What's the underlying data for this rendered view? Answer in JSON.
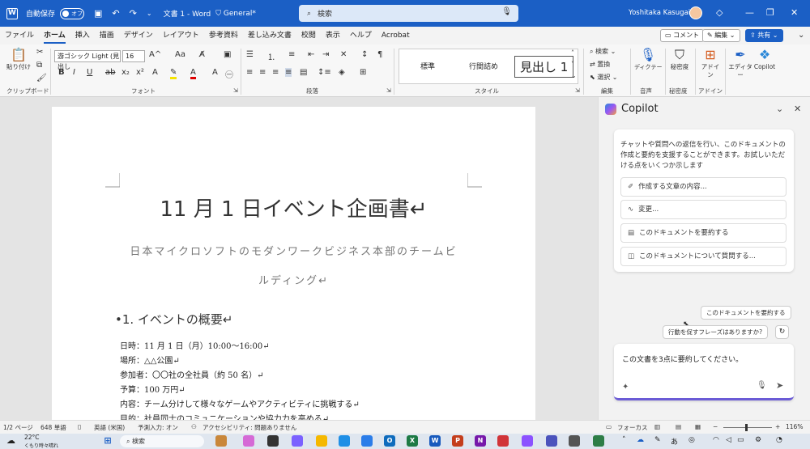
{
  "titlebar": {
    "autosave_label": "自動保存",
    "autosave_state": "オフ",
    "doc_title": "文書 1 - Word",
    "sensitivity": "General*",
    "search_placeholder": "検索",
    "user_name": "Yoshitaka Kasugai"
  },
  "tabs": [
    "ファイル",
    "ホーム",
    "挿入",
    "描画",
    "デザイン",
    "レイアウト",
    "参考資料",
    "差し込み文書",
    "校閲",
    "表示",
    "ヘルプ",
    "Acrobat"
  ],
  "ribbon_buttons": {
    "comments": "コメント",
    "edit": "編集",
    "share": "共有"
  },
  "ribbon": {
    "clipboard": {
      "paste": "貼り付け",
      "label": "クリップボード"
    },
    "font": {
      "name": "游ゴシック Light (見出し",
      "size": "16",
      "label": "フォント"
    },
    "paragraph": {
      "label": "段落"
    },
    "styles": {
      "items": [
        "標準",
        "行間詰め",
        "見出し 1"
      ],
      "label": "スタイル"
    },
    "editing": {
      "find": "検索",
      "replace": "置換",
      "select": "選択",
      "label": "編集"
    },
    "voice": {
      "dictate": "ディクテーション",
      "label": "音声"
    },
    "sensitivity": {
      "name": "秘密度",
      "label": "秘密度"
    },
    "addins": {
      "name": "アドイン",
      "label": "アドイン"
    },
    "editor": "エディター",
    "copilot": "Copilot"
  },
  "document": {
    "title": "11 月 1 日イベント企画書↵",
    "subtitle_line1": "日本マイクロソフトのモダンワークビジネス本部のチームビ",
    "subtitle_line2": "ルディング↵",
    "heading1": "•1. イベントの概要↵",
    "paragraphs": [
      "日時：11 月 1 日（月）10:00～16:00↵",
      "場所：△△公園↵",
      "参加者：〇〇社の全社員（約 50 名）↵",
      "予算：100 万円↵",
      "内容：チーム分けして様々なゲームやアクティビティに挑戦する↵",
      "目的：社員同士のコミュニケーションや協力力を高める↵"
    ]
  },
  "copilot": {
    "title": "Copilot",
    "intro": "チャットや質問への返信を行い、このドキュメントの作成と要約を支援することができます。お試しいただける点をいくつか示します",
    "suggestions": [
      {
        "icon": "pen-icon",
        "label": "作成する文章の内容..."
      },
      {
        "icon": "wand-icon",
        "label": "変更..."
      },
      {
        "icon": "doc-icon",
        "label": "このドキュメントを要約する"
      },
      {
        "icon": "chat-icon",
        "label": "このドキュメントについて質問する..."
      }
    ],
    "chip1": "このドキュメントを要約する",
    "chip2": "行動を促すフレーズはありますか?",
    "input_value": "この文書を3点に要約してください。"
  },
  "statusbar": {
    "page": "1/2 ページ",
    "words": "648 単語",
    "language": "英語 (米国)",
    "predictive": "予測入力: オン",
    "accessibility": "アクセシビリティ: 問題ありません",
    "focus": "フォーカス",
    "zoom": "116%"
  },
  "taskbar": {
    "temperature": "22°C",
    "weather": "くもり時々晴れ",
    "search": "検索",
    "ime": "あ"
  },
  "colors": {
    "accent": "#1b5fc5",
    "copilot_bar": "#6b5bd6"
  }
}
